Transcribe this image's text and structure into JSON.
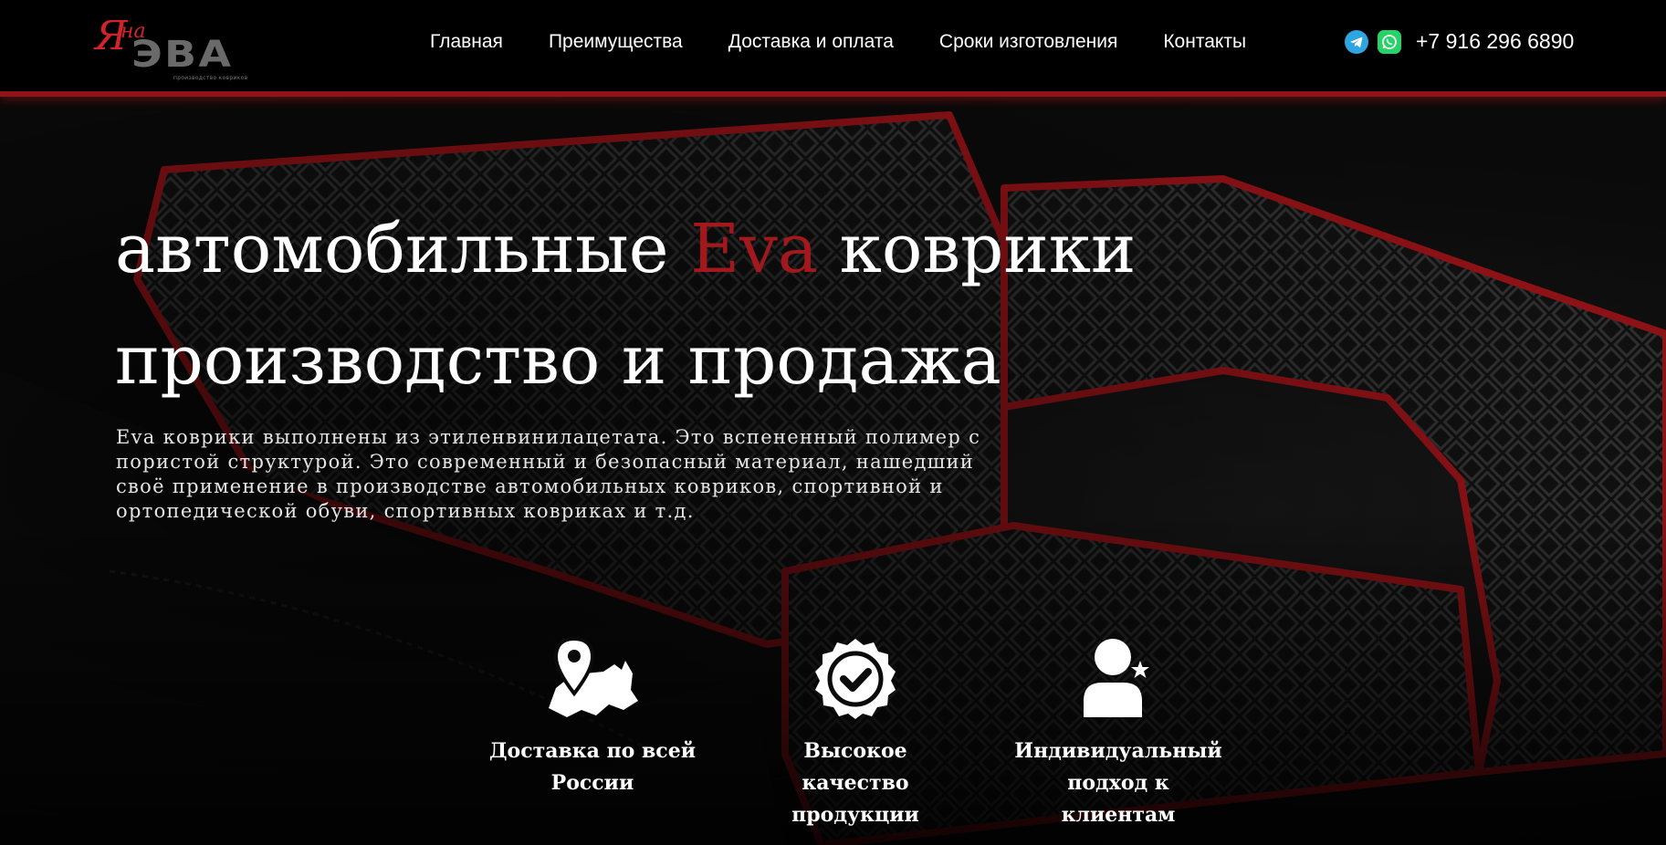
{
  "header": {
    "logo": {
      "ya": "Я",
      "na": "на",
      "eva": "ЭВА",
      "subtitle": "производство ковриков"
    },
    "nav": [
      "Главная",
      "Преимущества",
      "Доставка и оплата",
      "Сроки изготовления",
      "Контакты"
    ],
    "contacts": {
      "icons": [
        "telegram-icon",
        "whatsapp-icon"
      ],
      "phone": "+7 916 296 6890"
    }
  },
  "hero": {
    "title": {
      "line1_before": "автомобильные ",
      "line1_accent": "Eva",
      "line1_after": " коврики",
      "line2": "производство и продажа"
    },
    "description": "Eva коврики выполнены из этиленвинилацетата. Это вспененный полимер с пористой структурой. Это современный и безопасный материал, нашедший своё применение в производстве автомобильных ковриков, спортивной и ортопедической обуви, спортивных ковриках и т.д.",
    "features": [
      {
        "icon": "map-pin-icon",
        "label": "Доставка по всей России"
      },
      {
        "icon": "quality-badge-icon",
        "label": "Высокое качество продукции"
      },
      {
        "icon": "user-star-icon",
        "label": "Индивидуальный подход к клиентам"
      }
    ]
  },
  "colors": {
    "accent": "#a3181c",
    "header_border": "#8f1418",
    "background": "#0a0a0a",
    "text": "#ffffff",
    "telegram": "#2ca5e0",
    "whatsapp": "#25d366"
  }
}
